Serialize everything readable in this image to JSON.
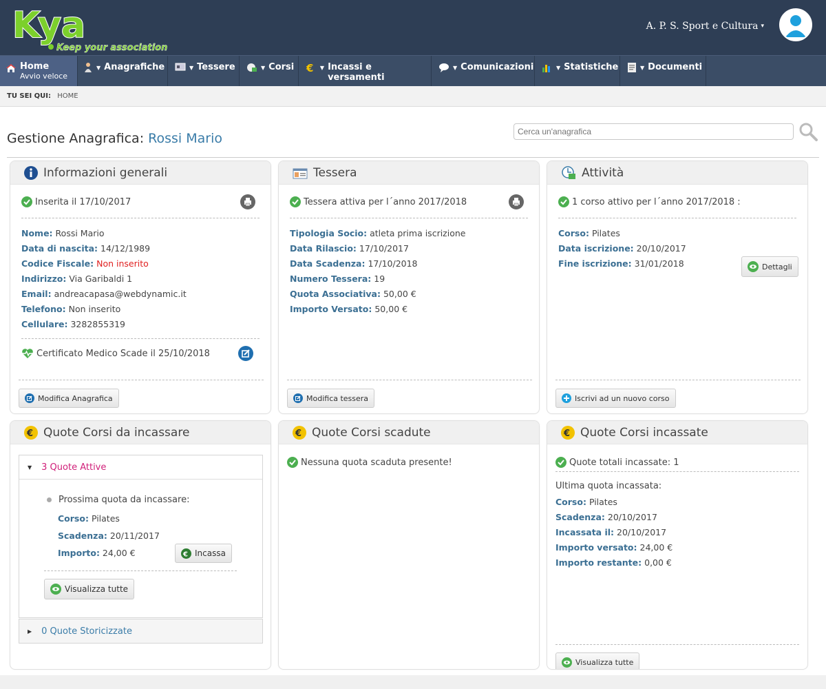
{
  "header": {
    "logo_text": "Kya",
    "logo_tagline": "Keep your association",
    "account_name": "A. P. S. Sport e Cultura",
    "colors": {
      "topbar": "#2e3e55",
      "nav": "#3b4d66",
      "logo_green": "#7cd02c",
      "link_blue": "#3a7ca8",
      "label_blue": "#3b6f93"
    }
  },
  "nav": {
    "items": [
      {
        "label": "Home",
        "sub": "Avvio veloce",
        "icon": "home-icon"
      },
      {
        "label": "Anagrafiche",
        "icon": "person-icon"
      },
      {
        "label": "Tessere",
        "icon": "card-icon"
      },
      {
        "label": "Corsi",
        "icon": "courses-icon"
      },
      {
        "label": "Incassi e versamenti",
        "icon": "euro-icon"
      },
      {
        "label": "Comunicazioni",
        "icon": "chat-icon"
      },
      {
        "label": "Statistiche",
        "icon": "bar-chart-icon"
      },
      {
        "label": "Documenti",
        "icon": "document-icon"
      }
    ]
  },
  "breadcrumb": {
    "label": "TU SEI QUI:",
    "current": "HOME"
  },
  "page": {
    "title_prefix": "Gestione Anagrafica:",
    "title_name": "Rossi Mario",
    "search_placeholder": "Cerca un'anagrafica"
  },
  "info": {
    "title": "Informazioni generali",
    "status": "Inserita il 17/10/2017",
    "fields": [
      {
        "k": "Nome:",
        "v": "Rossi Mario"
      },
      {
        "k": "Data di nascita:",
        "v": "14/12/1989"
      },
      {
        "k": "Codice Fiscale:",
        "v": "Non inserito"
      },
      {
        "k": "Indirizzo:",
        "v": "Via Garibaldi 1"
      },
      {
        "k": "Email:",
        "v": "andreacapasa@webdynamic.it"
      },
      {
        "k": "Telefono:",
        "v": "Non inserito"
      },
      {
        "k": "Cellulare:",
        "v": "3282855319"
      }
    ],
    "certificate": "Certificato Medico Scade il 25/10/2018",
    "button": "Modifica Anagrafica"
  },
  "tessera": {
    "title": "Tessera",
    "status": "Tessera attiva per l´anno 2017/2018",
    "fields": [
      {
        "k": "Tipologia Socio:",
        "v": "atleta prima iscrizione"
      },
      {
        "k": "Data Rilascio:",
        "v": "17/10/2017"
      },
      {
        "k": "Data Scadenza:",
        "v": "17/10/2018"
      },
      {
        "k": "Numero Tessera:",
        "v": "19"
      },
      {
        "k": "Quota Associativa:",
        "v": "50,00 €"
      },
      {
        "k": "Importo Versato:",
        "v": "50,00 €"
      }
    ],
    "button": "Modifica tessera"
  },
  "attivita": {
    "title": "Attività",
    "status": "1 corso attivo per l´anno 2017/2018 :",
    "fields": [
      {
        "k": "Corso:",
        "v": "Pilates"
      },
      {
        "k": "Data iscrizione:",
        "v": "20/10/2017"
      },
      {
        "k": "Fine iscrizione:",
        "v": "31/01/2018"
      }
    ],
    "details_button": "Dettagli",
    "button": "Iscrivi ad un nuovo corso"
  },
  "quote_da_incassare": {
    "title": "Quote Corsi da incassare",
    "active_label": "3 Quote Attive",
    "next_label": "Prossima quota da incassare:",
    "fields": [
      {
        "k": "Corso:",
        "v": "Pilates"
      },
      {
        "k": "Scadenza:",
        "v": "20/11/2017"
      },
      {
        "k": "Importo:",
        "v": "24,00 €"
      }
    ],
    "incassa_button": "Incassa",
    "view_all_button": "Visualizza tutte",
    "historic_label": "0 Quote Storicizzate"
  },
  "quote_scadute": {
    "title": "Quote Corsi scadute",
    "status": "Nessuna quota scaduta presente!"
  },
  "quote_incassate": {
    "title": "Quote Corsi incassate",
    "status": "Quote totali incassate: 1",
    "last_label": "Ultima quota incassata:",
    "fields": [
      {
        "k": "Corso:",
        "v": "Pilates"
      },
      {
        "k": "Scadenza:",
        "v": "20/10/2017"
      },
      {
        "k": "Incassata il:",
        "v": "20/10/2017"
      },
      {
        "k": "Importo versato:",
        "v": "24,00 €"
      },
      {
        "k": "Importo restante:",
        "v": "0,00 €"
      }
    ],
    "button": "Visualizza tutte"
  }
}
